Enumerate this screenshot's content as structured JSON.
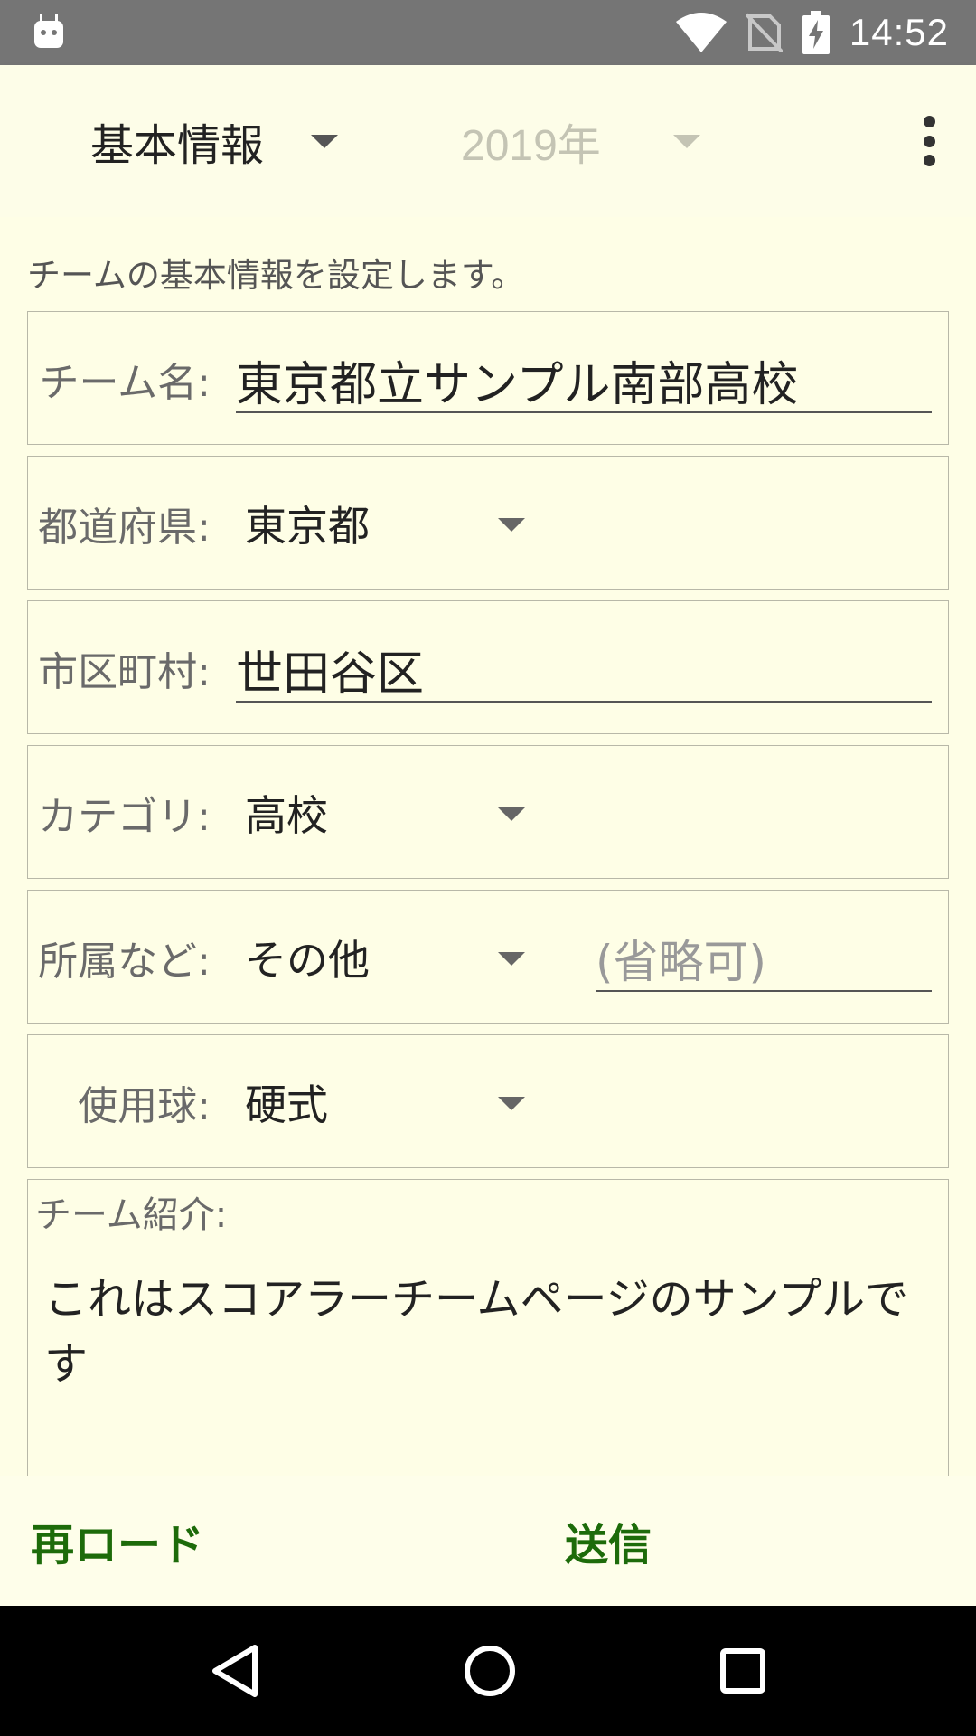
{
  "status_bar": {
    "time": "14:52"
  },
  "toolbar": {
    "section_spinner": "基本情報",
    "year_spinner": "2019年"
  },
  "form": {
    "description": "チームの基本情報を設定します。",
    "team_name_label": "チーム名:",
    "team_name_value": "東京都立サンプル南部高校",
    "prefecture_label": "都道府県:",
    "prefecture_value": "東京都",
    "city_label": "市区町村:",
    "city_value": "世田谷区",
    "category_label": "カテゴリ:",
    "category_value": "高校",
    "affiliation_label": "所属など:",
    "affiliation_value": "その他",
    "affiliation_optional_placeholder": "(省略可)",
    "ball_label": "使用球:",
    "ball_value": "硬式",
    "intro_label": "チーム紹介:",
    "intro_value": "これはスコアラーチームページのサンプルです"
  },
  "buttons": {
    "reload": "再ロード",
    "send": "送信"
  },
  "colors": {
    "background": "#fefee6",
    "accent_text": "#1d6b0a",
    "status_bar": "#757575"
  }
}
